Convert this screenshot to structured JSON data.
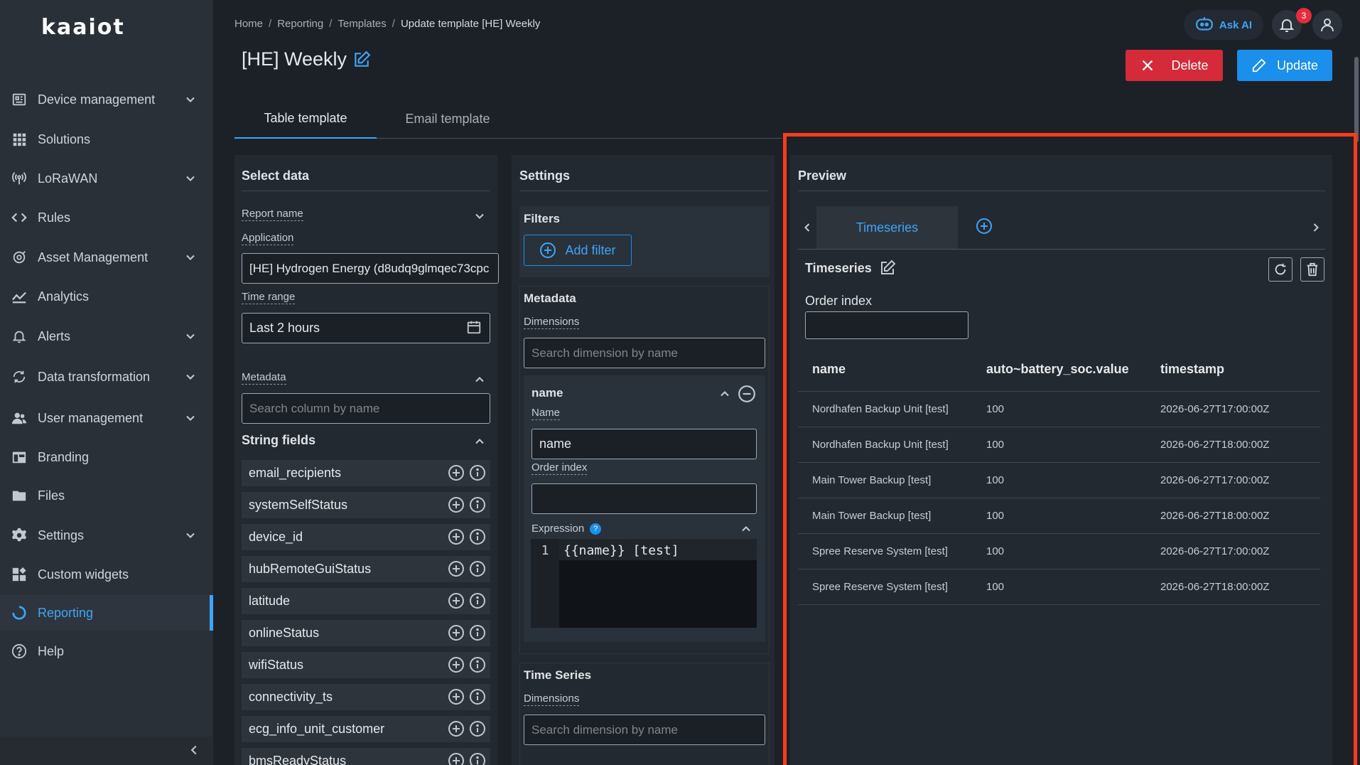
{
  "app": {
    "logo_text": "kaaiot"
  },
  "sidebar": {
    "items": [
      {
        "label": "Device management",
        "icon": "device-icon",
        "expandable": true
      },
      {
        "label": "Solutions",
        "icon": "grid-icon",
        "expandable": false
      },
      {
        "label": "LoRaWAN",
        "icon": "antenna-icon",
        "expandable": true
      },
      {
        "label": "Rules",
        "icon": "code-icon",
        "expandable": false
      },
      {
        "label": "Asset Management",
        "icon": "asset-icon",
        "expandable": true
      },
      {
        "label": "Analytics",
        "icon": "analytics-icon",
        "expandable": false
      },
      {
        "label": "Alerts",
        "icon": "bell-icon",
        "expandable": true
      },
      {
        "label": "Data transformation",
        "icon": "transform-icon",
        "expandable": true
      },
      {
        "label": "User management",
        "icon": "users-icon",
        "expandable": true
      },
      {
        "label": "Branding",
        "icon": "branding-icon",
        "expandable": false
      },
      {
        "label": "Files",
        "icon": "folder-icon",
        "expandable": false
      },
      {
        "label": "Settings",
        "icon": "gear-icon",
        "expandable": true
      },
      {
        "label": "Custom widgets",
        "icon": "widgets-icon",
        "expandable": false
      },
      {
        "label": "Reporting",
        "icon": "reporting-icon",
        "expandable": false,
        "active": true
      },
      {
        "label": "Help",
        "icon": "help-icon",
        "expandable": false
      }
    ]
  },
  "header": {
    "breadcrumb": [
      "Home",
      "Reporting",
      "Templates",
      "Update template [HE] Weekly"
    ],
    "title": "[HE] Weekly",
    "ask_ai": "Ask AI",
    "notification_count": "3",
    "delete_label": "Delete",
    "update_label": "Update"
  },
  "tabs": {
    "table": "Table template",
    "email": "Email template"
  },
  "select_data": {
    "title": "Select data",
    "report_name_label": "Report name",
    "application_label": "Application",
    "application_value": "[HE] Hydrogen Energy (d8udq9glmqec73cpc",
    "time_range_label": "Time range",
    "time_range_value": "Last 2 hours",
    "metadata_label": "Metadata",
    "search_placeholder": "Search column by name",
    "string_fields_title": "String fields",
    "string_fields": [
      "email_recipients",
      "systemSelfStatus",
      "device_id",
      "hubRemoteGuiStatus",
      "latitude",
      "onlineStatus",
      "wifiStatus",
      "connectivity_ts",
      "ecg_info_unit_customer",
      "bmsReadyStatus"
    ]
  },
  "settings": {
    "title": "Settings",
    "filters_title": "Filters",
    "add_filter": "Add filter",
    "metadata_title": "Metadata",
    "dimensions_label": "Dimensions",
    "search_dimension_placeholder": "Search dimension by name",
    "dimension": {
      "title": "name",
      "name_label": "Name",
      "name_value": "name",
      "order_index_label": "Order index",
      "order_index_value": "",
      "expression_label": "Expression",
      "line_number": "1",
      "expression_code": "{{name}} [test]"
    },
    "time_series_title": "Time Series",
    "ts_dimensions_label": "Dimensions",
    "ts_search_placeholder": "Search dimension by name"
  },
  "preview": {
    "title": "Preview",
    "tab_label": "Timeseries",
    "section_title": "Timeseries",
    "order_index_label": "Order index",
    "order_index_value": "",
    "columns": [
      "name",
      "auto~battery_soc.value",
      "timestamp"
    ],
    "rows": [
      [
        "Nordhafen Backup Unit [test]",
        "100",
        "2026-06-27T17:00:00Z"
      ],
      [
        "Nordhafen Backup Unit [test]",
        "100",
        "2026-06-27T18:00:00Z"
      ],
      [
        "Main Tower Backup [test]",
        "100",
        "2026-06-27T17:00:00Z"
      ],
      [
        "Main Tower Backup [test]",
        "100",
        "2026-06-27T18:00:00Z"
      ],
      [
        "Spree Reserve System [test]",
        "100",
        "2026-06-27T17:00:00Z"
      ],
      [
        "Spree Reserve System [test]",
        "100",
        "2026-06-27T18:00:00Z"
      ]
    ]
  },
  "colors": {
    "accent": "#3ea5f5",
    "danger": "#d52a3a",
    "highlight": "#ff3b1b"
  }
}
